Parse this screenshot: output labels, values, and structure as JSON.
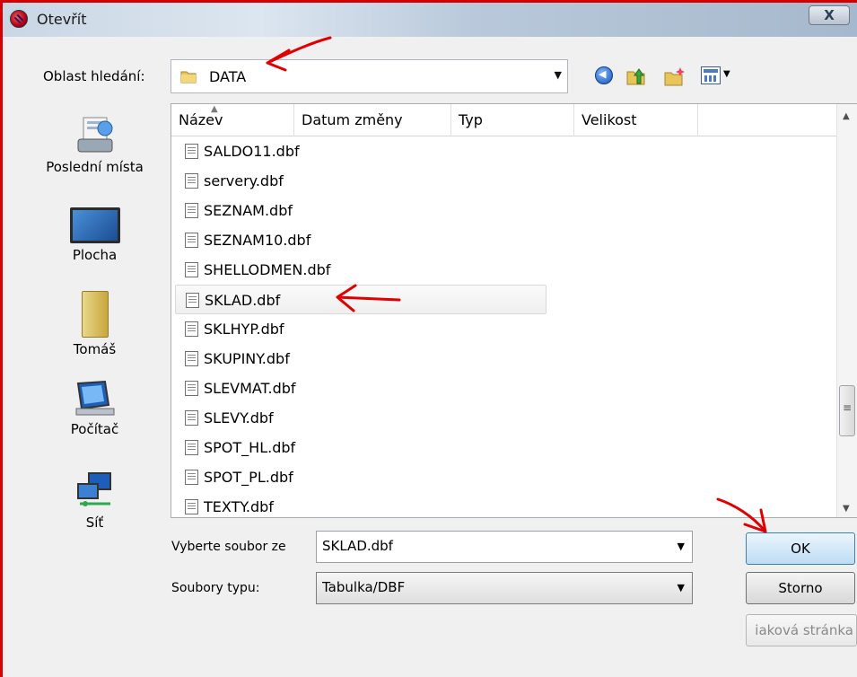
{
  "window": {
    "title": "Otevřít",
    "close_label": "X"
  },
  "look_in": {
    "label": "Oblast hledání:",
    "value": "DATA"
  },
  "toolbar": {
    "back_icon": "back-arrow-icon",
    "up_icon": "up-folder-icon",
    "new_folder_icon": "new-folder-icon",
    "views_icon": "views-menu-icon"
  },
  "places": [
    {
      "label": "Poslední místa",
      "icon": "recent-places-icon"
    },
    {
      "label": "Plocha",
      "icon": "desktop-icon"
    },
    {
      "label": "Tomáš",
      "icon": "user-folder-icon"
    },
    {
      "label": "Počítač",
      "icon": "computer-icon"
    },
    {
      "label": "Síť",
      "icon": "network-icon"
    }
  ],
  "columns": {
    "name": "Název",
    "date": "Datum změny",
    "type": "Typ",
    "size": "Velikost"
  },
  "files": [
    "SALDO11.dbf",
    "servery.dbf",
    "SEZNAM.dbf",
    "SEZNAM10.dbf",
    "SHELLODMEN.dbf",
    "SKLAD.dbf",
    "SKLHYP.dbf",
    "SKUPINY.dbf",
    "SLEVMAT.dbf",
    "SLEVY.dbf",
    "SPOT_HL.dbf",
    "SPOT_PL.dbf",
    "TEXTY.dbf"
  ],
  "hovered_file": "SKLAD.dbf",
  "file_name": {
    "label": "Vyberte soubor ze",
    "value": "SKLAD.dbf"
  },
  "file_type": {
    "label": "Soubory typu:",
    "value": "Tabulka/DBF"
  },
  "buttons": {
    "ok": "OK",
    "cancel": "Storno",
    "help": "iaková stránka"
  },
  "colors": {
    "annotation": "#e00000",
    "frame": "#d40000",
    "ok_accent": "#3c7fb1"
  }
}
